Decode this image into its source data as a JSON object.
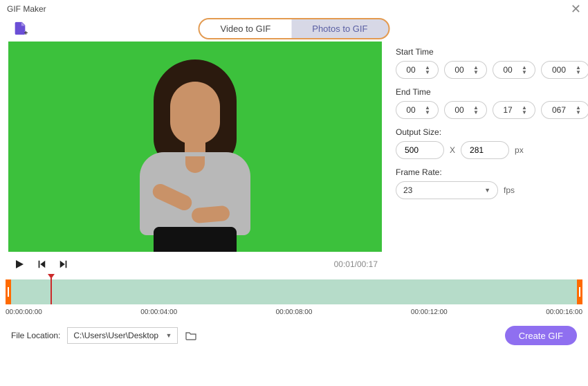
{
  "header": {
    "title": "GIF Maker"
  },
  "tabs": {
    "video": "Video to GIF",
    "photos": "Photos to GIF"
  },
  "props": {
    "start_label": "Start Time",
    "end_label": "End Time",
    "start": {
      "h": "00",
      "m": "00",
      "s": "00",
      "ms": "000"
    },
    "end": {
      "h": "00",
      "m": "00",
      "s": "17",
      "ms": "067"
    },
    "output_label": "Output Size:",
    "output_w": "500",
    "output_h": "281",
    "output_sep": "X",
    "output_unit": "px",
    "fps_label": "Frame Rate:",
    "fps_value": "23",
    "fps_unit": "fps"
  },
  "playbar": {
    "time": "00:01/00:17"
  },
  "timeline": {
    "ticks": [
      "00:00:00:00",
      "00:00:04:00",
      "00:00:08:00",
      "00:00:12:00",
      "00:00:16:00"
    ]
  },
  "footer": {
    "loc_label": "File Location:",
    "path": "C:\\Users\\User\\Desktop",
    "create": "Create GIF"
  }
}
